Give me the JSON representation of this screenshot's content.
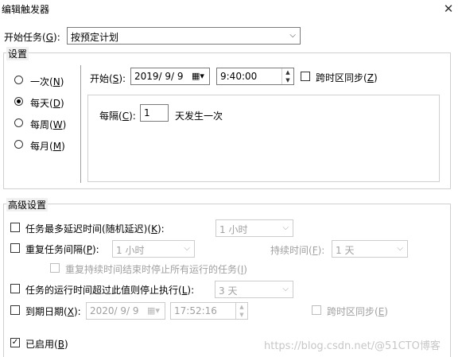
{
  "window": {
    "title": "编辑触发器",
    "close_glyph": "✕"
  },
  "begin_task": {
    "label": "开始任务",
    "accel": "G",
    "value": "按预定计划"
  },
  "settings": {
    "title": "设置",
    "radios": [
      {
        "label": "一次",
        "accel": "N",
        "selected": false
      },
      {
        "label": "每天",
        "accel": "D",
        "selected": true
      },
      {
        "label": "每周",
        "accel": "W",
        "selected": false
      },
      {
        "label": "每月",
        "accel": "M",
        "selected": false
      }
    ],
    "start": {
      "label": "开始",
      "accel": "S",
      "date": "2019/  9/  9",
      "time": "9:40:00"
    },
    "sync_tz": {
      "label": "跨时区同步",
      "accel": "Z",
      "checked": false
    },
    "recur": {
      "label": "每隔",
      "accel": "C",
      "value": "1",
      "suffix": "天发生一次"
    }
  },
  "advanced": {
    "title": "高级设置",
    "delay": {
      "label": "任务最多延迟时间(随机延迟)",
      "accel": "K",
      "checked": false,
      "value": "1 小时"
    },
    "repeat": {
      "label": "重复任务间隔",
      "accel": "P",
      "checked": false,
      "value": "1 小时",
      "duration_label": "持续时间",
      "duration_accel": "F",
      "duration_value": "1 天"
    },
    "stop_running": {
      "label": "重复持续时间结束时停止所有运行的任务",
      "accel": "I",
      "checked": false
    },
    "stop_if_longer": {
      "label": "任务的运行时间超过此值则停止执行",
      "accel": "L",
      "checked": false,
      "value": "3 天"
    },
    "expire": {
      "label": "到期日期",
      "accel": "X",
      "checked": false,
      "date": "2020/  9/  9",
      "time": "17:52:16",
      "sync_label": "跨时区同步",
      "sync_accel": "E"
    },
    "enabled": {
      "label": "已启用",
      "accel": "B",
      "checked": true
    }
  },
  "watermark": "https://blog.csdn.net/@51CTO博客",
  "colors": {
    "panel_bg": "#f0f0f0",
    "group_border": "#d0d0d0",
    "disabled_text": "#a0a0a0"
  }
}
